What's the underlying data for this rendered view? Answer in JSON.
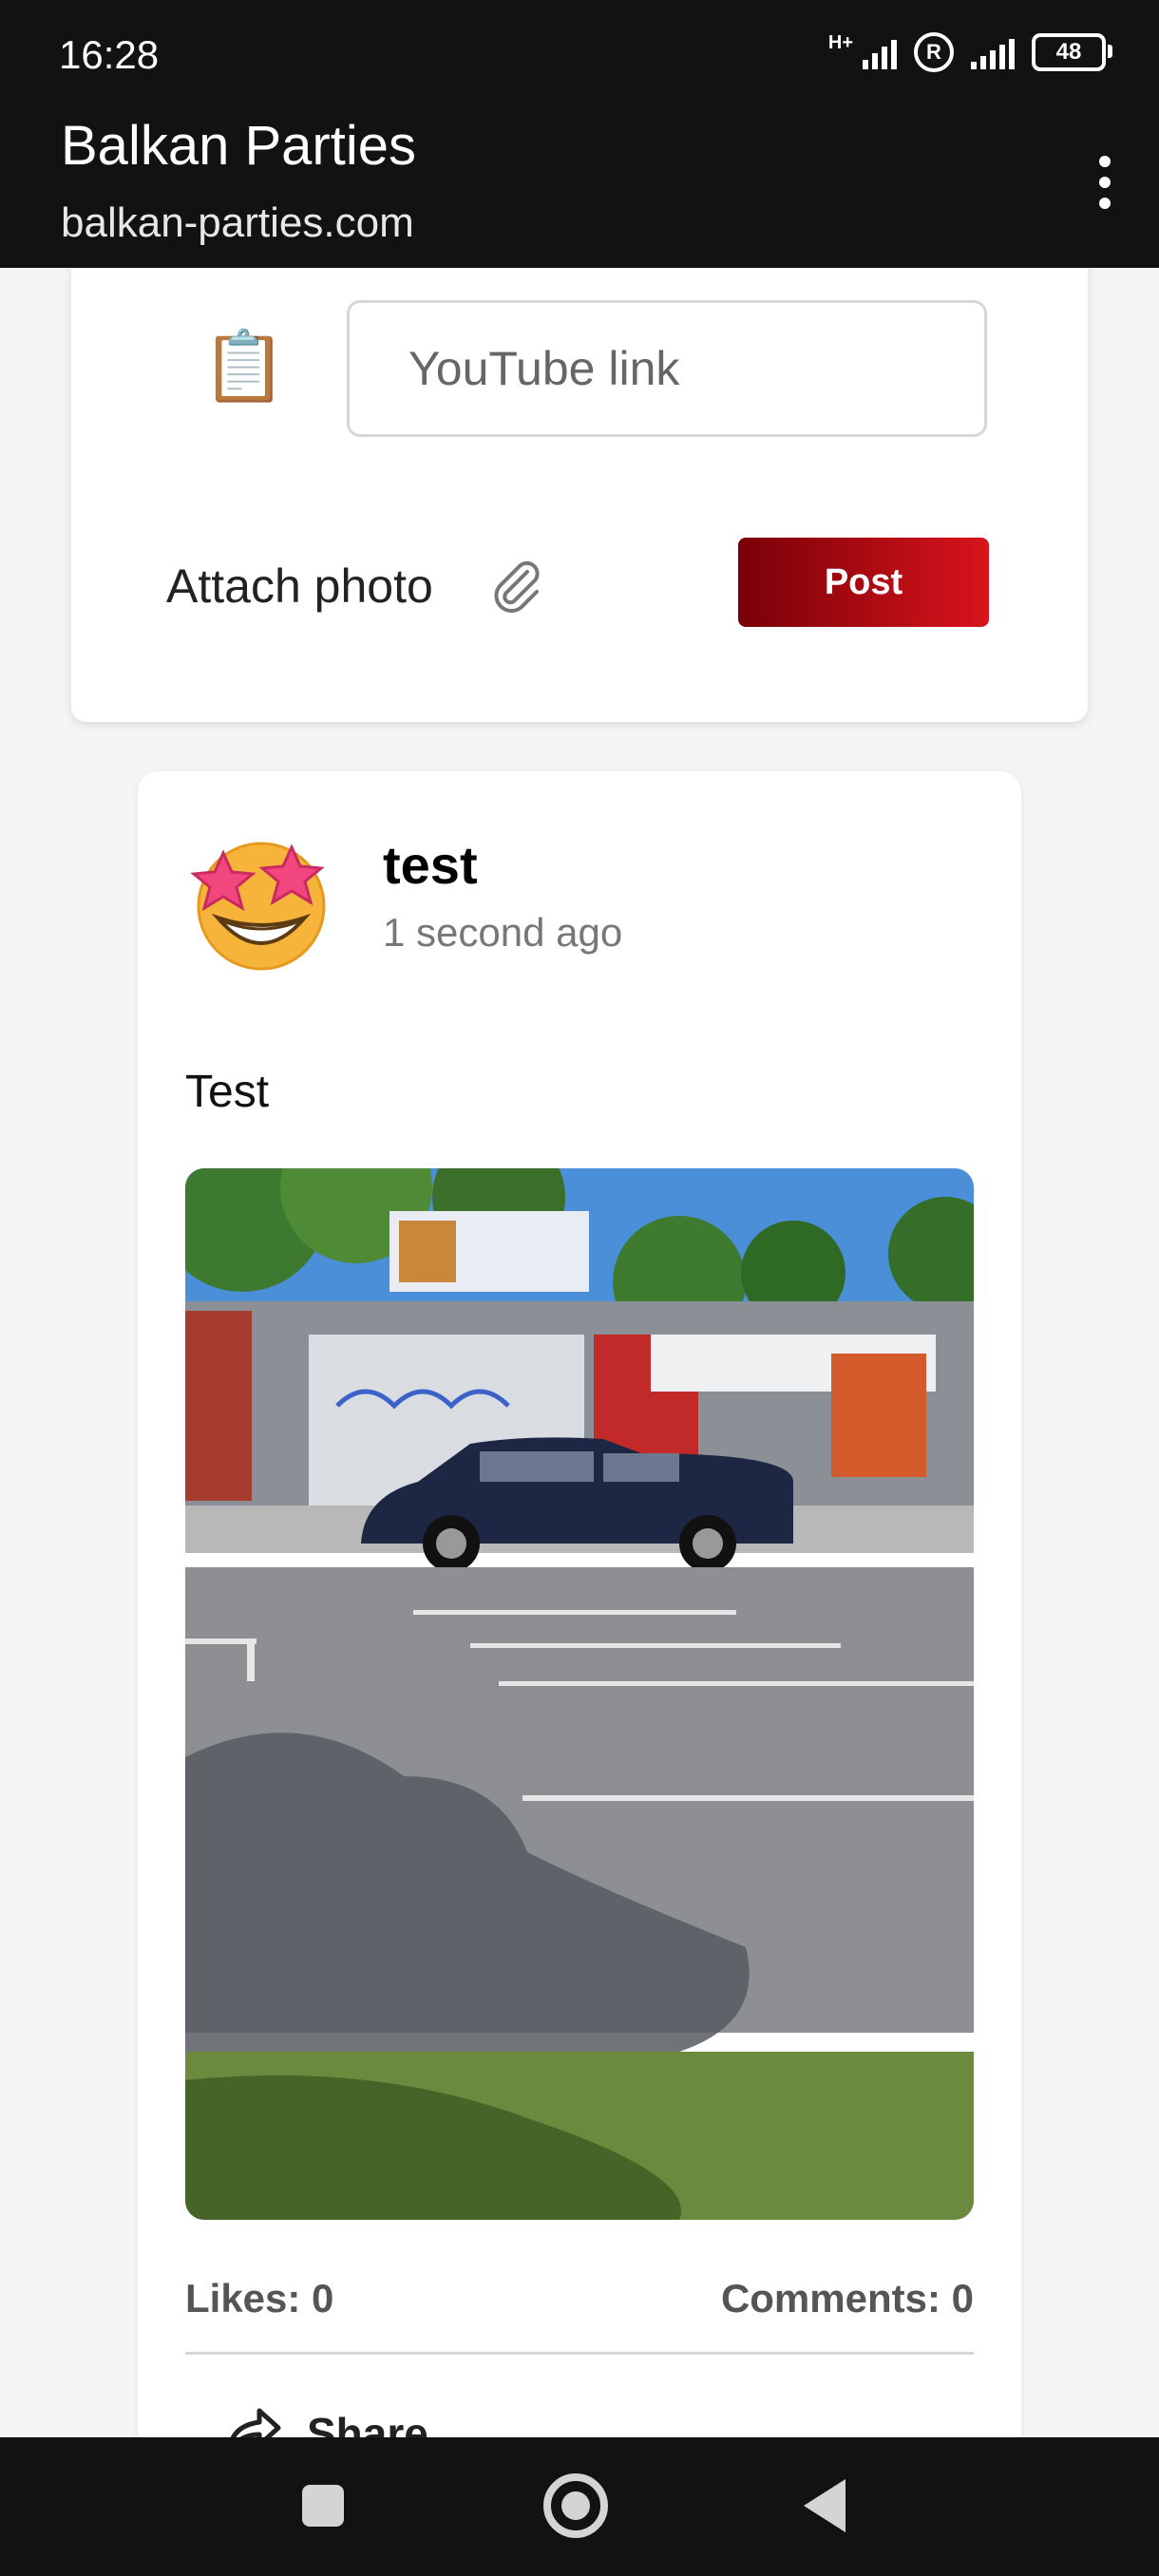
{
  "status_bar": {
    "time": "16:28",
    "network": "H+",
    "roaming": "R",
    "battery": "48"
  },
  "browser": {
    "title": "Balkan Parties",
    "url": "balkan-parties.com",
    "menu_icon": "kebab-menu-icon"
  },
  "composer": {
    "icon": "clipboard-icon",
    "youtube_placeholder": "YouTube link",
    "attach_label": "Attach photo",
    "attach_icon": "paperclip-icon",
    "post_label": "Post",
    "post_button_colors": [
      "#7a0008",
      "#d9141c"
    ]
  },
  "post": {
    "avatar_icon": "star-struck-emoji",
    "author": "test",
    "time_ago": "1 second ago",
    "text": "Test",
    "likes_label": "Likes: 0",
    "comments_label": "Comments: 0",
    "share_label": "Share"
  },
  "nav": {
    "recents_icon": "recents-square-icon",
    "home_icon": "home-circle-icon",
    "back_icon": "back-triangle-icon"
  }
}
